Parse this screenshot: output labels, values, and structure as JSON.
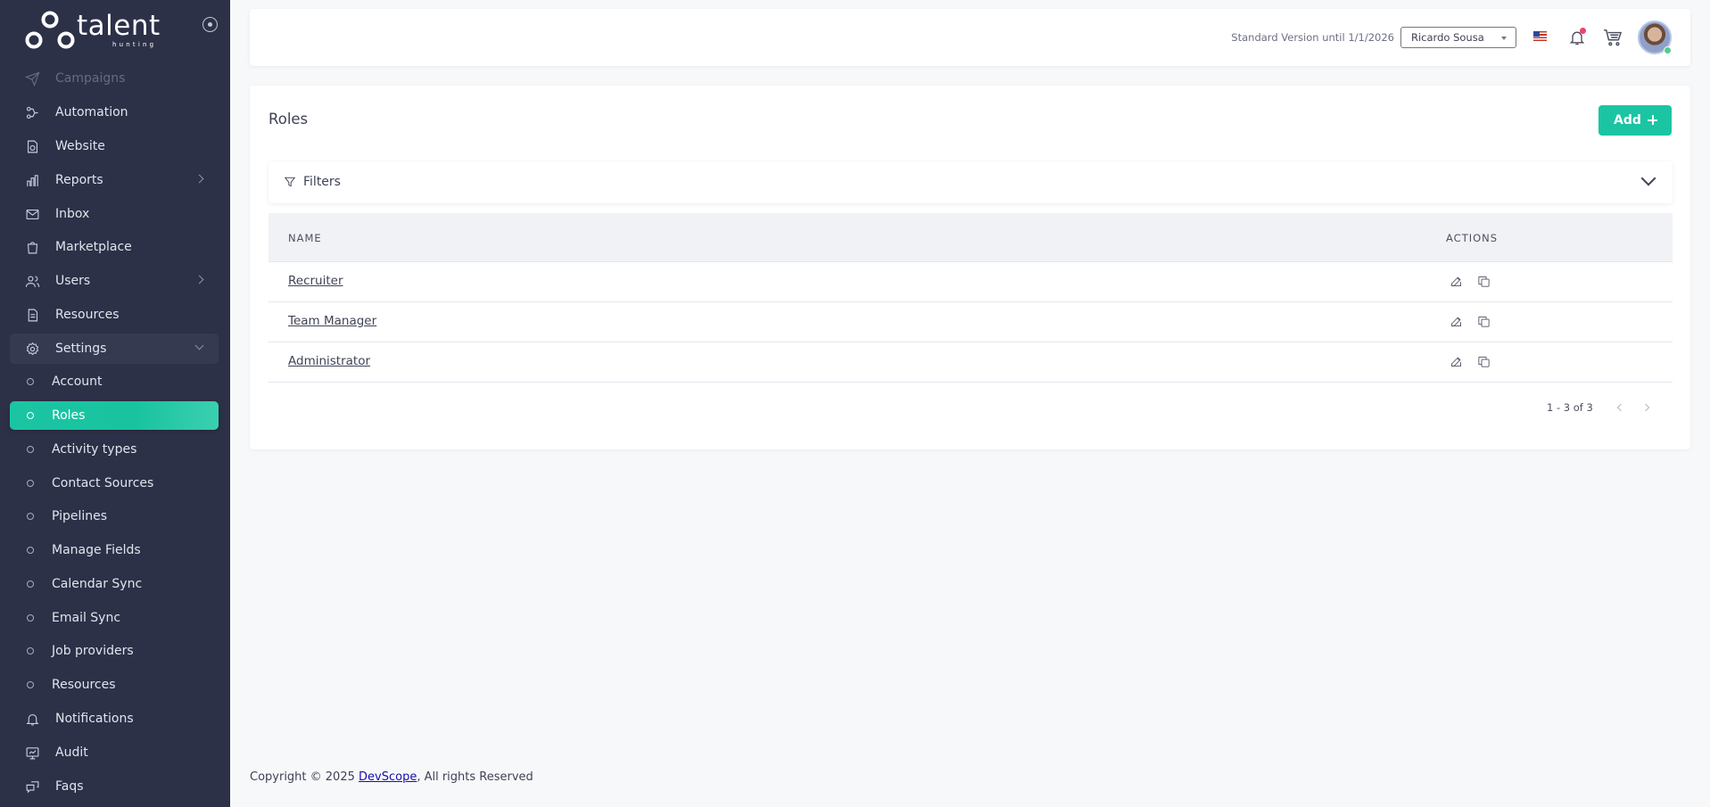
{
  "sidebar": {
    "logo_text": "talent",
    "logo_sub": "hunting",
    "items": [
      {
        "label": "Campaigns",
        "icon": "paper-plane-icon"
      },
      {
        "label": "Automation",
        "icon": "automation-icon"
      },
      {
        "label": "Website",
        "icon": "website-icon"
      },
      {
        "label": "Reports",
        "icon": "bar-chart-icon"
      },
      {
        "label": "Inbox",
        "icon": "mail-icon"
      },
      {
        "label": "Marketplace",
        "icon": "shopping-bag-icon"
      },
      {
        "label": "Users",
        "icon": "users-icon"
      },
      {
        "label": "Resources",
        "icon": "document-icon"
      },
      {
        "label": "Settings",
        "icon": "gear-icon"
      }
    ],
    "settings_sub": [
      "Account",
      "Roles",
      "Activity types",
      "Contact Sources",
      "Pipelines",
      "Manage Fields",
      "Calendar Sync",
      "Email Sync",
      "Job providers",
      "Resources"
    ],
    "bottom_items": [
      {
        "label": "Notifications",
        "icon": "bell-icon"
      },
      {
        "label": "Audit",
        "icon": "monitor-icon"
      },
      {
        "label": "Faqs",
        "icon": "faq-icon"
      }
    ]
  },
  "header": {
    "version_text": "Standard Version until 1/1/2026",
    "user_select": "Ricardo Sousa",
    "language_flag": "us-flag-icon",
    "colors": {
      "notification_badge": "#f1416c",
      "online_status": "#50cd89"
    }
  },
  "page": {
    "title": "Roles",
    "add_label": "Add",
    "filters_label": "Filters",
    "columns": {
      "name": "NAME",
      "actions": "ACTIONS"
    },
    "rows": [
      "Recruiter",
      "Team Manager",
      "Administrator"
    ],
    "pagination": "1 - 3 of 3"
  },
  "footer": {
    "prefix": "Copyright © 2025 ",
    "link": "DevScope",
    "suffix": ", All rights Reserved"
  },
  "colors": {
    "sidebar_bg": "#2c3148",
    "accent": "#1bc5a3",
    "page_bg": "#f7f8fa"
  }
}
